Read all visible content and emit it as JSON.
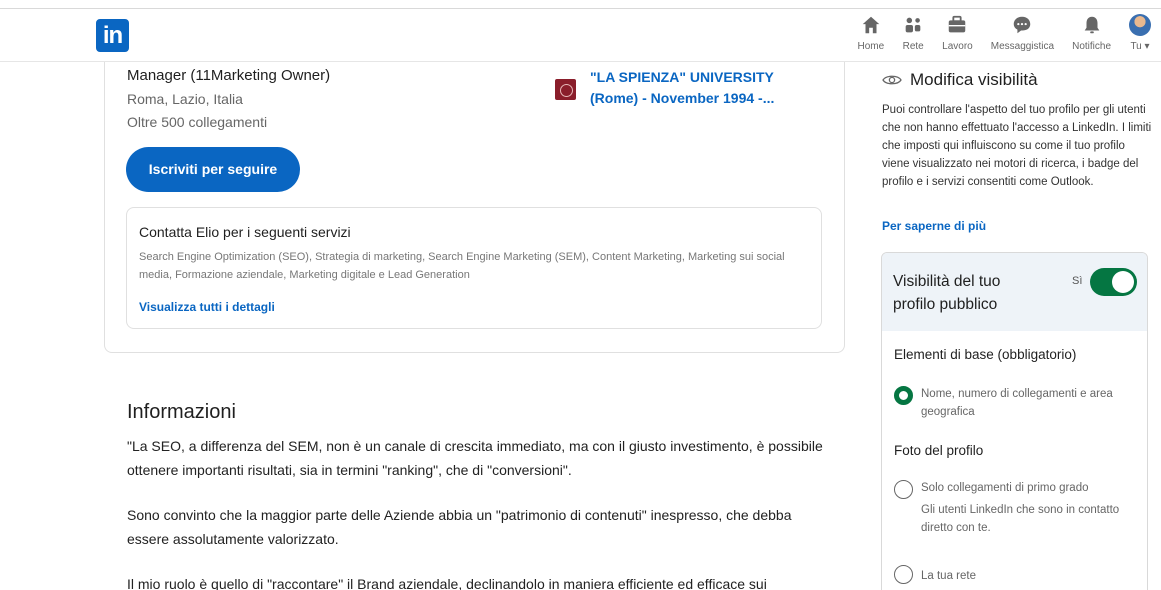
{
  "nav": {
    "logo": "in",
    "items": [
      {
        "id": "home",
        "label": "Home",
        "icon": "home-icon"
      },
      {
        "id": "rete",
        "label": "Rete",
        "icon": "network-icon"
      },
      {
        "id": "lavoro",
        "label": "Lavoro",
        "icon": "briefcase-icon"
      },
      {
        "id": "messaggistica",
        "label": "Messaggistica",
        "icon": "message-icon"
      },
      {
        "id": "notifiche",
        "label": "Notifiche",
        "icon": "bell-icon"
      },
      {
        "id": "tu",
        "label": "Tu ▾",
        "icon": "avatar"
      }
    ]
  },
  "profile": {
    "headline": "Manager (11Marketing Owner)",
    "location": "Roma, Lazio, Italia",
    "connections": "Oltre 500 collegamenti",
    "education": "\"LA SPIENZA\" UNIVERSITY (Rome) - November 1994 -...",
    "follow_button": "Iscriviti per seguire"
  },
  "services": {
    "title": "Contatta Elio per i seguenti servizi",
    "list": "Search Engine Optimization (SEO), Strategia di marketing, Search Engine Marketing (SEM), Content Marketing, Marketing sui social media, Formazione aziendale, Marketing digitale e Lead Generation",
    "link": "Visualizza tutti i dettagli"
  },
  "about": {
    "title": "Informazioni",
    "p1": "\"La SEO, a differenza del SEM, non è un canale di crescita immediato, ma con il giusto investimento, è possibile ottenere importanti risultati, sia in termini \"ranking\", che di \"conversioni\".",
    "p2": "Sono convinto che la maggior parte delle Aziende abbia un \"patrimonio di contenuti\" inespresso, che debba essere assolutamente valorizzato.",
    "p3": "Il mio ruolo è quello di \"raccontare\" il Brand aziendale, declinandolo in maniera efficiente ed efficace sui"
  },
  "visibility": {
    "title": "Modifica visibilità",
    "description": "Puoi controllare l'aspetto del tuo profilo per gli utenti che non hanno effettuato l'accesso a LinkedIn. I limiti che imposti qui influiscono su come il tuo profilo viene visualizzato nei motori di ricerca, i badge del profilo e i servizi consentiti come Outlook.",
    "learn_more": "Per saperne di più",
    "card_title": "Visibilità del tuo profilo pubblico",
    "toggle_label": "Sì",
    "toggle_on": true,
    "section_basic": "Elementi di base (obbligatorio)",
    "option_basic": "Nome, numero di collegamenti e area geografica",
    "section_photo": "Foto del profilo",
    "option_first": "Solo collegamenti di primo grado",
    "option_first_desc": "Gli utenti LinkedIn che sono in contatto diretto con te.",
    "option_network": "La tua rete"
  },
  "colors": {
    "brand_blue": "#0a66c2",
    "toggle_green": "#057642",
    "header_bg": "#eef3f8"
  }
}
